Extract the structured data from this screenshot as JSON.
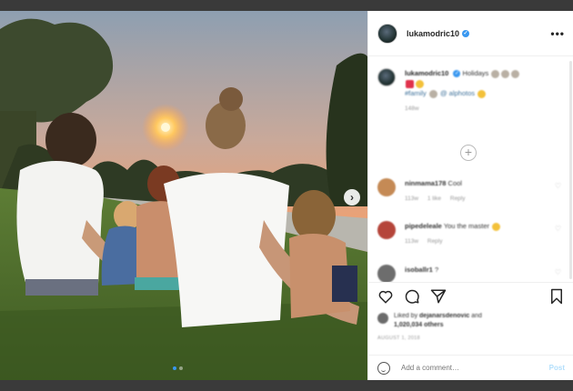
{
  "post": {
    "username": "lukamodric10",
    "verified": true,
    "caption": {
      "username": "lukamodric10",
      "text": "Holidays",
      "hashtags": "#family",
      "tag": "@ alphotos",
      "time": "148w"
    },
    "photo": {
      "description_icon": "family-sunset-photo",
      "carousel_index": 1,
      "carousel_count": 2
    }
  },
  "comments": [
    {
      "username": "ninmama178",
      "text": "Cool",
      "time": "113w",
      "likes": "1 like",
      "reply": "Reply",
      "avatar_color": "#c58a55"
    },
    {
      "username": "pipedeleale",
      "text": "You the master",
      "time": "113w",
      "reply": "Reply",
      "avatar_color": "#b5453a"
    },
    {
      "username": "isoballr1",
      "text": "?",
      "avatar_color": "#6d6d6d"
    }
  ],
  "likes": {
    "liked_by_label": "Liked by",
    "liked_by_user": "dejanarsdenovic",
    "and_label": "and",
    "others_count": "1,020,034 others"
  },
  "post_date": "AUGUST 1, 2018",
  "add_comment": {
    "placeholder": "Add a comment…",
    "post_label": "Post"
  },
  "ui": {
    "load_more": "+",
    "more_options": "•••",
    "next": "›"
  }
}
